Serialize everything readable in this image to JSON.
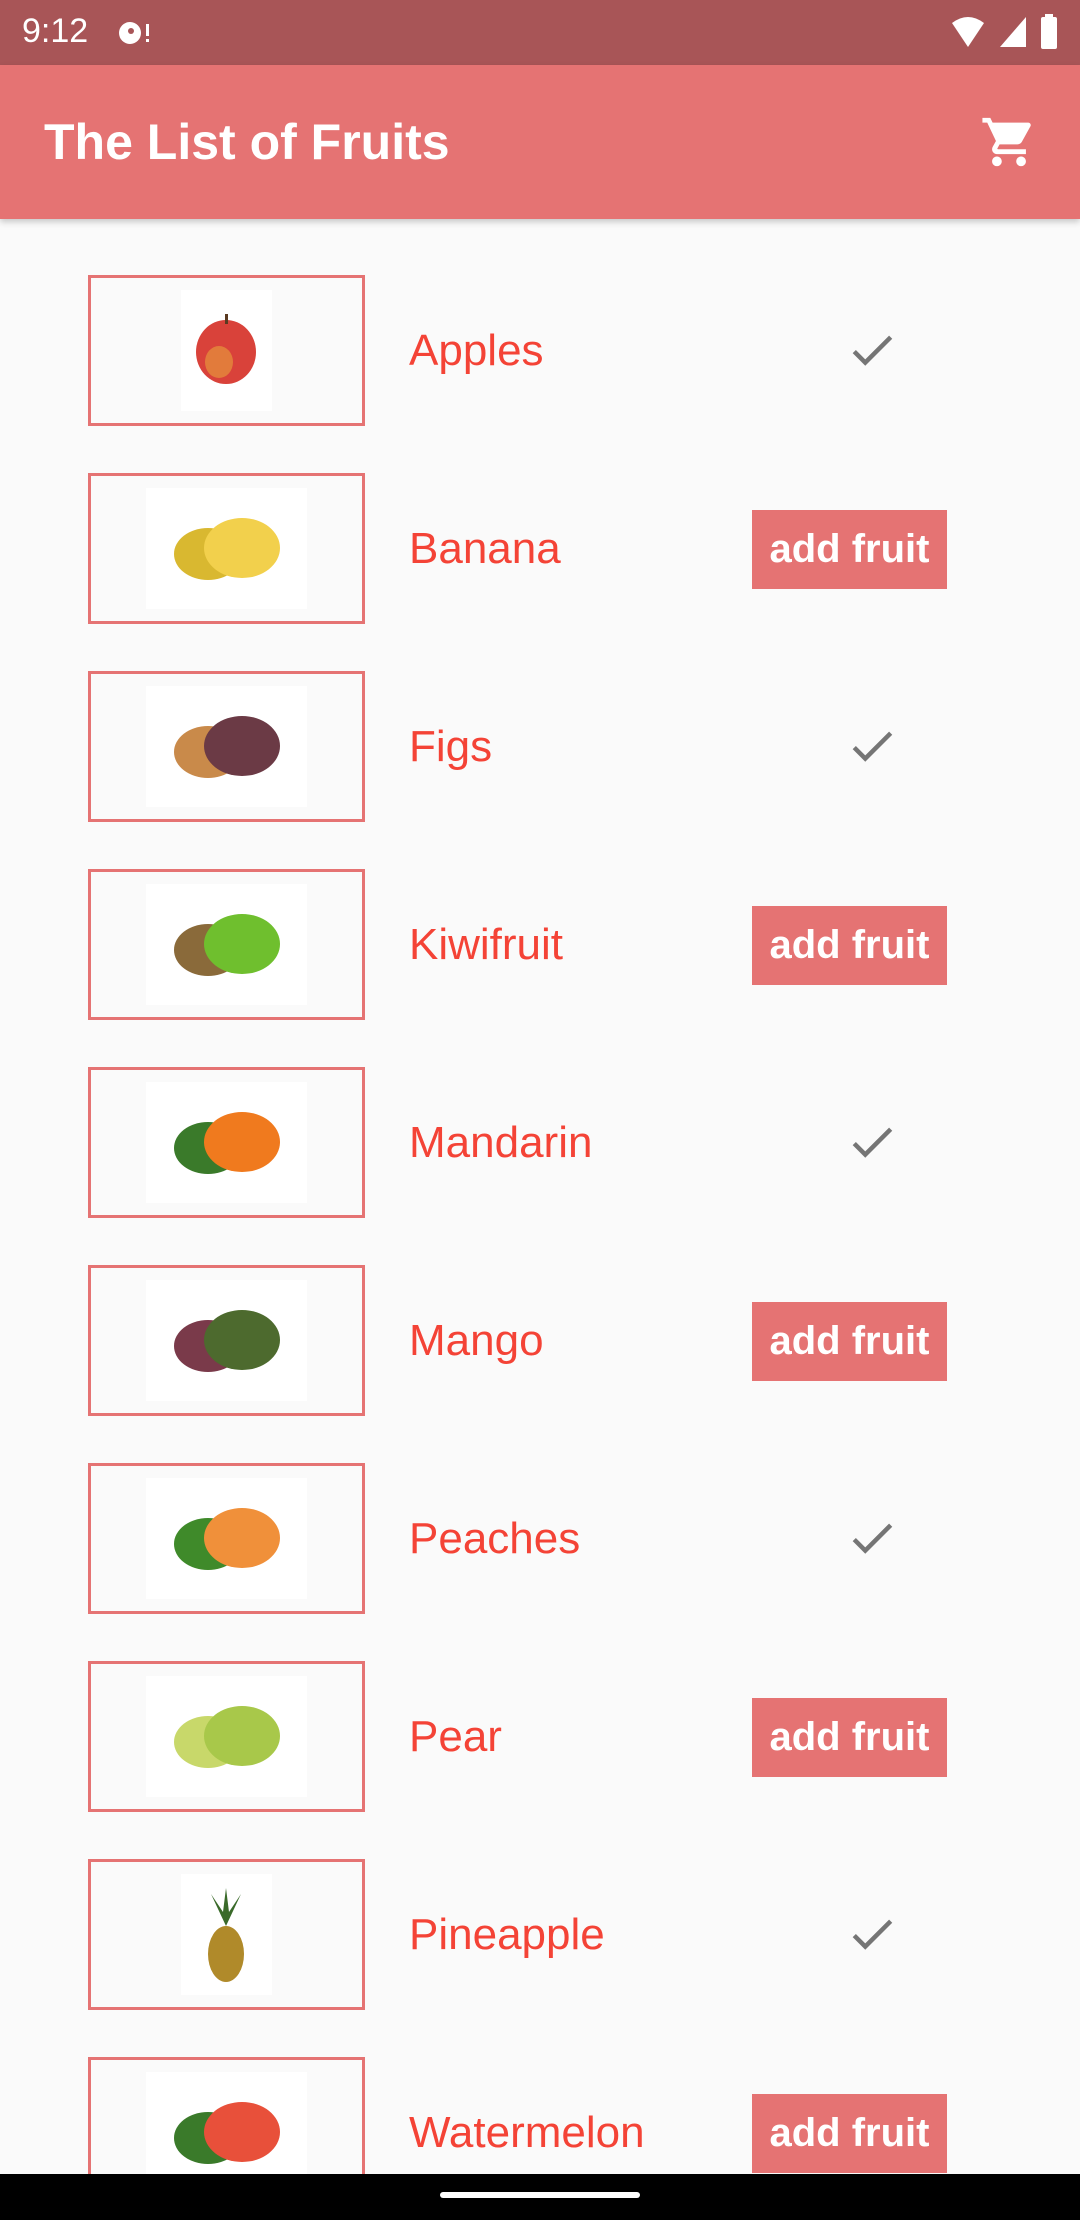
{
  "status_bar": {
    "time": "9:12"
  },
  "app_bar": {
    "title": "The List of Fruits",
    "cart_icon": "shopping-cart-icon"
  },
  "colors": {
    "primary": "#e57373",
    "status_bar": "#a85557",
    "fruit_text": "#f44336",
    "check": "#757575"
  },
  "fruits": [
    {
      "name": "Apples",
      "in_cart": true,
      "color": "#d9423a",
      "color2": "#e8a23c"
    },
    {
      "name": "Banana",
      "in_cart": false,
      "button_label": "add fruit",
      "color": "#f2d04c",
      "color2": "#d9b830"
    },
    {
      "name": "Figs",
      "in_cart": true,
      "color": "#6b3a45",
      "color2": "#c98a4a"
    },
    {
      "name": "Kiwifruit",
      "in_cart": false,
      "button_label": "add fruit",
      "color": "#6fbf2e",
      "color2": "#8a6a3a"
    },
    {
      "name": "Mandarin",
      "in_cart": true,
      "color": "#f07a1e",
      "color2": "#3a7a2a"
    },
    {
      "name": "Mango",
      "in_cart": false,
      "button_label": "add fruit",
      "color": "#4d6a2e",
      "color2": "#7a3a4a"
    },
    {
      "name": "Peaches",
      "in_cart": true,
      "color": "#f0903a",
      "color2": "#3f8a2a"
    },
    {
      "name": "Pear",
      "in_cart": false,
      "button_label": "add fruit",
      "color": "#a8c84a",
      "color2": "#c8d86a"
    },
    {
      "name": "Pineapple",
      "in_cart": true,
      "color": "#b08a2a",
      "color2": "#3a6a2a"
    },
    {
      "name": "Watermelon",
      "in_cart": false,
      "button_label": "add fruit",
      "color": "#e8503a",
      "color2": "#3a7a2a"
    }
  ]
}
